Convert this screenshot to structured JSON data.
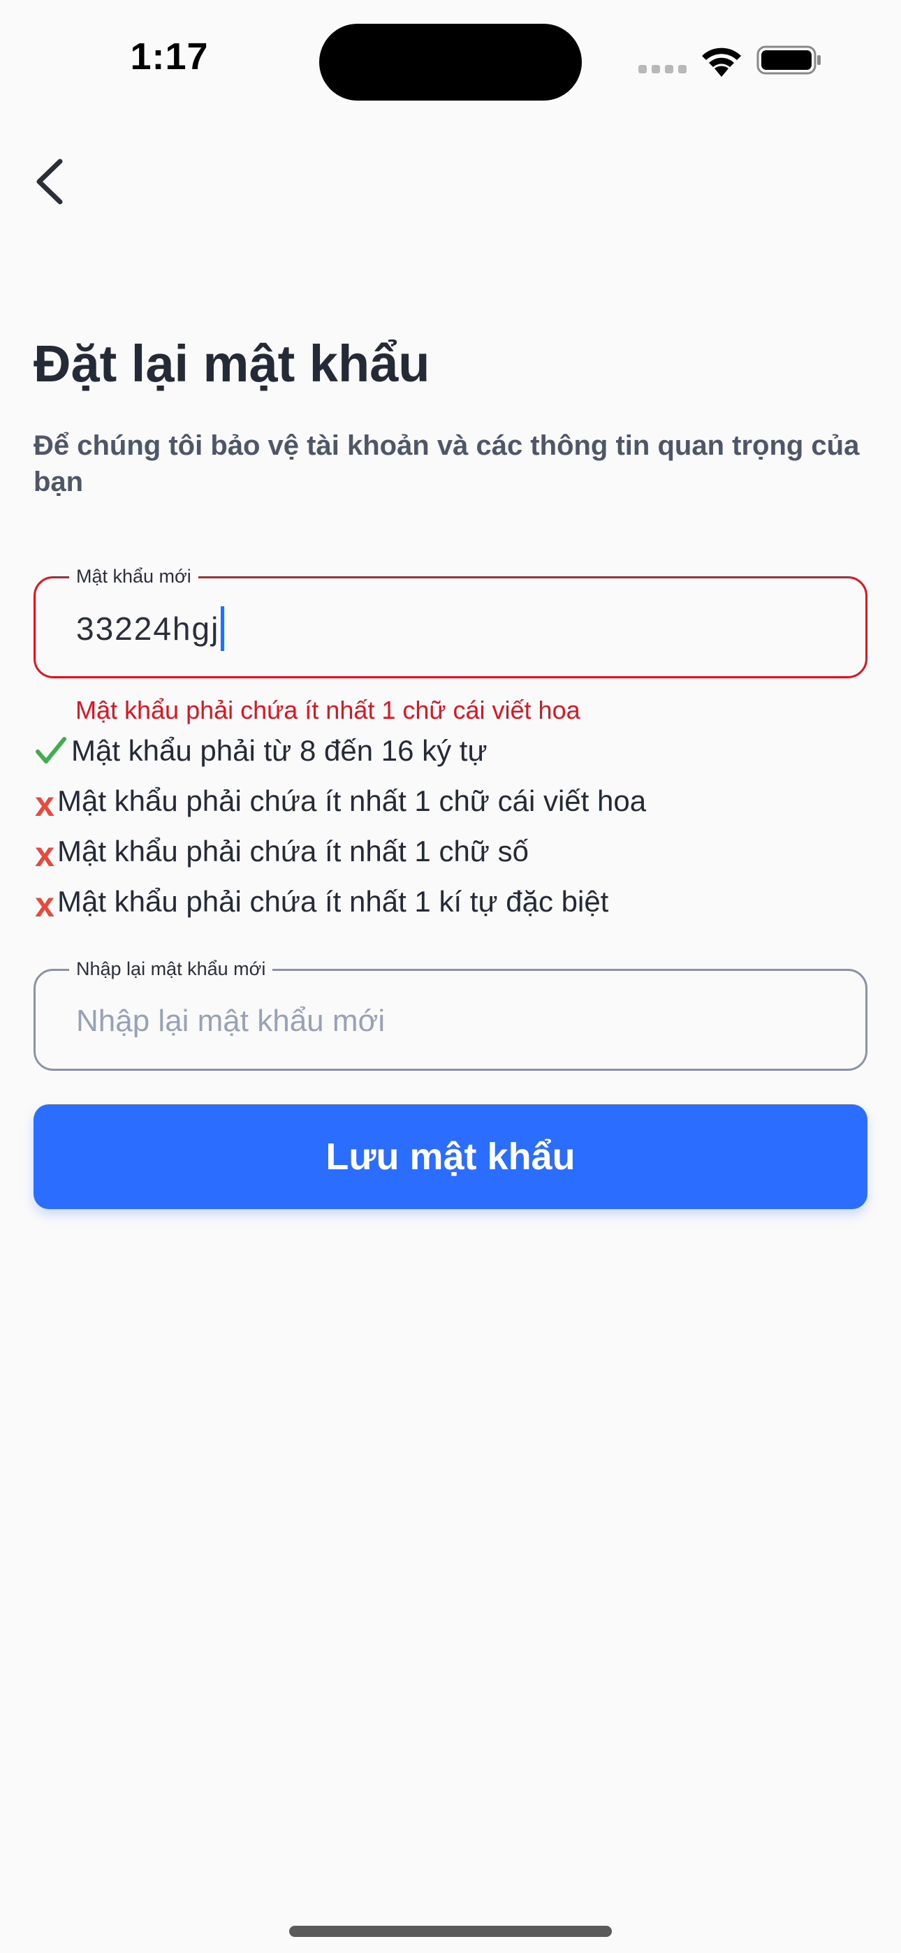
{
  "status_bar": {
    "time": "1:17"
  },
  "header": {
    "back_icon": "chevron-left-icon"
  },
  "page": {
    "title": "Đặt lại mật khẩu",
    "subtitle": "Để chúng tôi bảo vệ tài khoản và các thông tin quan trọng của bạn"
  },
  "new_password": {
    "label": "Mật khẩu mới",
    "value": "33224hgj",
    "error": "Mật khẩu phải chứa ít nhất 1 chữ cái viết hoa"
  },
  "rules": [
    {
      "text": "Mật khẩu phải từ 8 đến 16 ký tự",
      "status": "pass",
      "icon": "check-icon"
    },
    {
      "text": "Mật khẩu phải chứa ít nhất 1 chữ cái viết hoa",
      "status": "fail",
      "icon": "x-icon",
      "mark": "x"
    },
    {
      "text": "Mật khẩu phải chứa ít nhất 1 chữ số",
      "status": "fail",
      "icon": "x-icon",
      "mark": "x"
    },
    {
      "text": "Mật khẩu phải chứa ít nhất 1 kí tự đặc biệt",
      "status": "fail",
      "icon": "x-icon",
      "mark": "x"
    }
  ],
  "confirm_password": {
    "label": "Nhập lại mật khẩu mới",
    "placeholder": "Nhập lại mật khẩu mới"
  },
  "save_button": {
    "label": "Lưu mật khẩu"
  },
  "colors": {
    "primary": "#2a6dff",
    "error": "#e0141e",
    "success": "#3fae4f",
    "fail_mark": "#e8493c"
  }
}
